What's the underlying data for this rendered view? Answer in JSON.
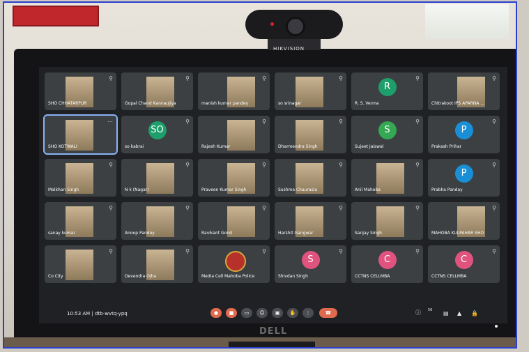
{
  "camera": {
    "brand": "HIKVISION"
  },
  "monitor": {
    "brand": "DELL"
  },
  "meeting": {
    "time": "10:53 AM",
    "separator": "|",
    "code": "dtb-wvtq-ypq",
    "participants_badge": "56"
  },
  "tiles": [
    {
      "name": "SHO CHHATARPUR",
      "type": "video"
    },
    {
      "name": "Gopal Chand Kannaujiya",
      "type": "video"
    },
    {
      "name": "manish kumar pandey",
      "type": "video"
    },
    {
      "name": "so srinagar",
      "type": "video"
    },
    {
      "name": "R. S. Verma",
      "type": "avatar",
      "letter": "R",
      "color": "#1e9e6a"
    },
    {
      "name": "Chitrakoot IPS APARNA ...",
      "type": "video"
    },
    {
      "name": "SHO KOTWALI",
      "type": "video",
      "active": true
    },
    {
      "name": "so kabrai",
      "type": "avatar",
      "letter": "SO",
      "color": "#1e9e6a"
    },
    {
      "name": "Rajesh Kumar",
      "type": "video"
    },
    {
      "name": "Dharmendra Singh",
      "type": "video"
    },
    {
      "name": "Sujeet Jaiswal",
      "type": "avatar",
      "letter": "S",
      "color": "#34a853"
    },
    {
      "name": "Prakash Prihar",
      "type": "avatar",
      "letter": "P",
      "color": "#1a8fd6"
    },
    {
      "name": "Malkhan Singh",
      "type": "video"
    },
    {
      "name": "N k (Nagar)",
      "type": "video"
    },
    {
      "name": "Praveen Kumar Singh",
      "type": "video"
    },
    {
      "name": "Sushma Chaurasia",
      "type": "video"
    },
    {
      "name": "Anil Mahoba",
      "type": "video"
    },
    {
      "name": "Prabha Panday",
      "type": "avatar",
      "letter": "P",
      "color": "#1a8fd6"
    },
    {
      "name": "sanay kumar",
      "type": "video"
    },
    {
      "name": "Anoop Pandey",
      "type": "video"
    },
    {
      "name": "Ravikant Gond",
      "type": "video"
    },
    {
      "name": "Harshit Gangwar",
      "type": "video"
    },
    {
      "name": "Sanjay Singh",
      "type": "video"
    },
    {
      "name": "MAHOBA KULPAHAR SHO",
      "type": "video"
    },
    {
      "name": "Co City",
      "type": "video"
    },
    {
      "name": "Devendra Ojha",
      "type": "video"
    },
    {
      "name": "Media Cell Mahoba Police",
      "type": "emblem"
    },
    {
      "name": "Shivdan Singh",
      "type": "avatar",
      "letter": "S",
      "color": "#e0537f"
    },
    {
      "name": "CCTNS CELLMBA",
      "type": "avatar",
      "letter": "C",
      "color": "#e0537f"
    },
    {
      "name": "CCTNS CELLMBA",
      "type": "avatar",
      "letter": "C",
      "color": "#e0537f"
    }
  ],
  "icons": {
    "mic_muted": "mic-off-icon",
    "more": "more-options-icon"
  }
}
